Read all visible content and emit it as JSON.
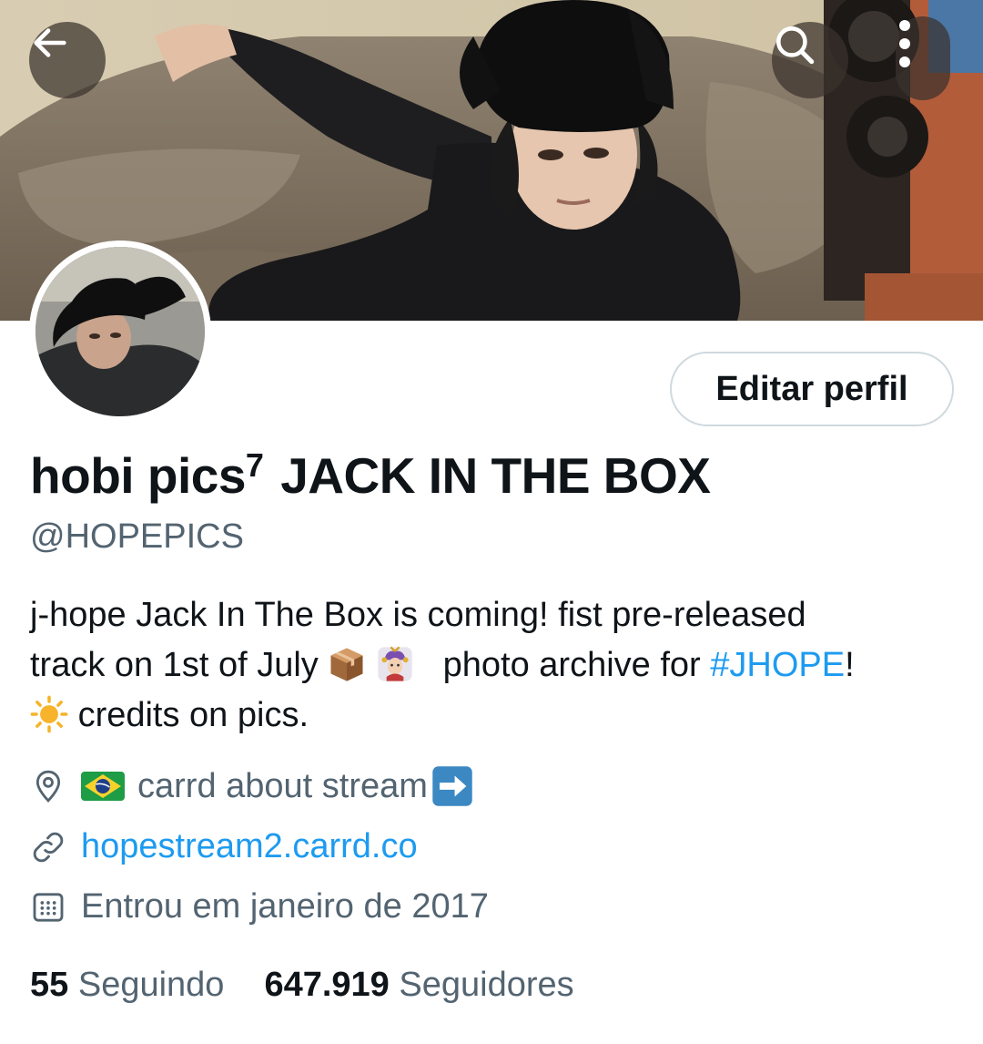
{
  "header": {
    "back_icon": "arrow-left-icon",
    "search_icon": "search-icon",
    "more_icon": "more-vertical-icon"
  },
  "profile": {
    "display_name_prefix": "hobi pics",
    "display_name_superscript": "7",
    "display_name_suffix": "JACK IN THE BOX",
    "handle": "@HOPEPICS",
    "edit_button_label": "Editar perfil",
    "bio": {
      "line1": "j-hope Jack In The Box is coming! fist pre-released",
      "line2_text": "track on 1st of July",
      "line2_emojis": [
        "package-emoji",
        "jester-emoji"
      ],
      "line2_after": "photo archive for",
      "hashtag": "#JHOPE",
      "line2_end": "!",
      "line3_emoji": "sun-emoji",
      "line3_text": "credits on pics."
    },
    "location_flag": "brazil-flag-emoji",
    "location": "carrd about stream",
    "location_end_emoji": "right-arrow-emoji",
    "link": "hopestream2.carrd.co",
    "joined": "Entrou em janeiro de 2017",
    "following_count": "55",
    "following_label": "Seguindo",
    "followers_count": "647.919",
    "followers_label": "Seguidores"
  },
  "colors": {
    "text_primary": "#0f1419",
    "text_secondary": "#536471",
    "link": "#1d9bf0",
    "border": "#cfd9de"
  }
}
